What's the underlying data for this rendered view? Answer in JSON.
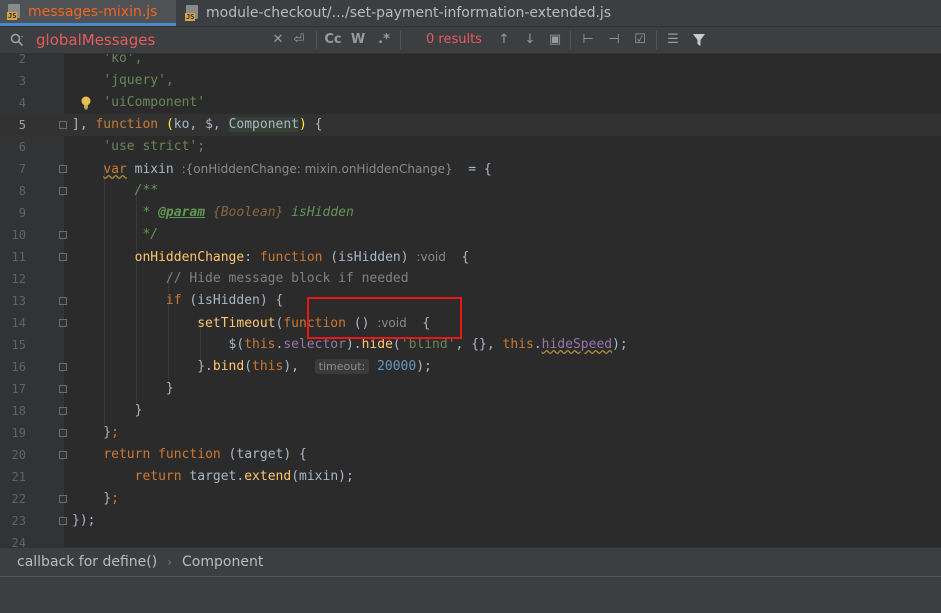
{
  "tabs": [
    {
      "label": "messages-mixin.js",
      "active": true,
      "icon": "js-file-icon"
    },
    {
      "label": "module-checkout/.../set-payment-information-extended.js",
      "active": false,
      "icon": "js-file-icon"
    }
  ],
  "find": {
    "query": "globalMessages",
    "results": "0 results",
    "match_case_label": "Cc",
    "words_label": "W",
    "regex_label": ".*"
  },
  "lines": [
    {
      "num": "2"
    },
    {
      "num": "3"
    },
    {
      "num": "4"
    },
    {
      "num": "5"
    },
    {
      "num": "6"
    },
    {
      "num": "7"
    },
    {
      "num": "8"
    },
    {
      "num": "9"
    },
    {
      "num": "10"
    },
    {
      "num": "11"
    },
    {
      "num": "12"
    },
    {
      "num": "13"
    },
    {
      "num": "14"
    },
    {
      "num": "15"
    },
    {
      "num": "16"
    },
    {
      "num": "17"
    },
    {
      "num": "18"
    },
    {
      "num": "19"
    },
    {
      "num": "20"
    },
    {
      "num": "21"
    },
    {
      "num": "22"
    },
    {
      "num": "23"
    },
    {
      "num": "24"
    }
  ],
  "code": {
    "l2": "'ko',",
    "l3": "'jquery',",
    "l4": "'uiComponent'",
    "l5_kw": "function",
    "l5_ko": "ko",
    "l5_dollar": "$",
    "l5_component": "Component",
    "l6": "'use strict';",
    "l7_var": "var",
    "l7_name": "mixin",
    "l7_hint": ":{onHiddenChange: mixin.onHiddenChange}",
    "l8": "/**",
    "l9_star": " * ",
    "l9_tag": "@param",
    "l9_type": "{Boolean}",
    "l9_name": "isHidden",
    "l10": " */",
    "l11_name": "onHiddenChange",
    "l11_kw": "function",
    "l11_param": "isHidden",
    "l11_hint": ":void",
    "l12": "// Hide message block if needed",
    "l13_kw": "if",
    "l13_param": "isHidden",
    "l14_fn": "setTimeout",
    "l14_kw": "function",
    "l14_hint": ":void",
    "l15_this": "this",
    "l15_sel": "selector",
    "l15_hide": "hide",
    "l15_str": "'blind'",
    "l15_this2": "this",
    "l15_speed": "hideSpeed",
    "l16_bind": "bind",
    "l16_this": "this",
    "l16_hint": "timeout:",
    "l16_num": "20000",
    "l20_kw": "return",
    "l20_kw2": "function",
    "l20_param": "target",
    "l21_kw": "return",
    "l21_target": "target",
    "l21_extend": "extend",
    "l21_mixin": "mixin"
  },
  "breadcrumb": [
    "callback for define()",
    "Component"
  ],
  "colors": {
    "accent_tab": "#f26522",
    "search_text": "#e85b5b",
    "highlight_box": "#e81818"
  }
}
